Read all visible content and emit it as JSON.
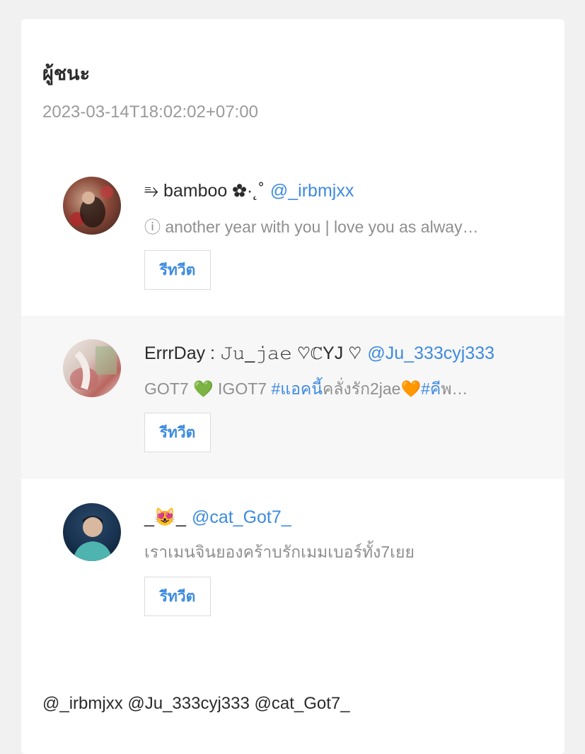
{
  "card": {
    "title": "ผู้ชนะ",
    "timestamp": "2023-03-14T18:02:02+07:00"
  },
  "winners": [
    {
      "name": "⥱ bamboo ✿·˛˚",
      "handle": "@_irbmjxx",
      "bio": "ⓘ another year with you | love you as alway…",
      "retweet_label": "รีทวีต"
    },
    {
      "name": "ErrrDay : 𝙹𝚞_𝚓𝚊𝚎 ♡ℂYJ ♡",
      "handle": "@Ju_333cyj333",
      "bio_parts": {
        "a": "GOT7 💚 IGOT7 ",
        "b": "#แอคน",
        "c": "ี้คลั่งรัก2jae🧡",
        "d": "#ค",
        "e": "ีพ…"
      },
      "retweet_label": "รีทวีต"
    },
    {
      "name": "_😻_",
      "handle": "@cat_Got7_",
      "bio": "เราเมนจินยองคร้าบรักเมมเบอร์ทั้ง7เยย",
      "retweet_label": "รีทวีต"
    }
  ],
  "mentions": "@_irbmjxx @Ju_333cyj333 @cat_Got7_",
  "colors": {
    "accent": "#3d8be0",
    "muted": "#8f8f8f",
    "alt_row": "#f7f7f7"
  }
}
